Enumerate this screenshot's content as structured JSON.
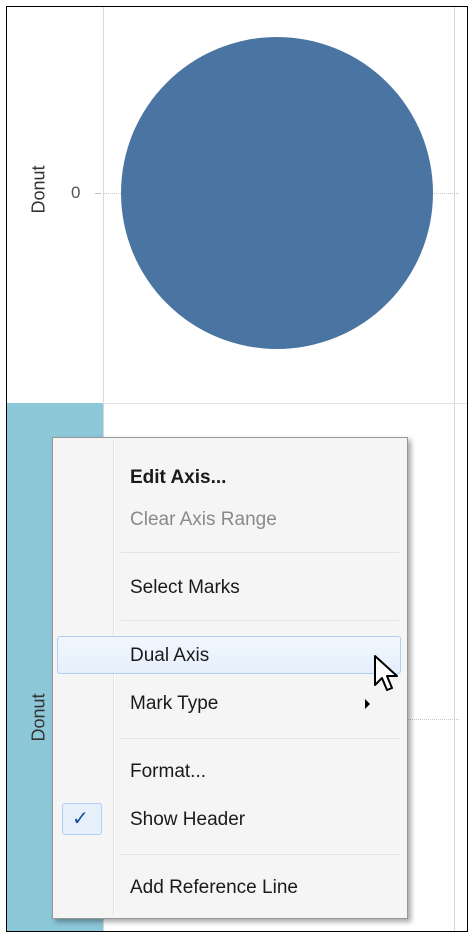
{
  "view": {
    "top_header": "Donut",
    "bottom_header": "Donut",
    "axis_tick": "0"
  },
  "colors": {
    "mark_fill": "#4a74a2",
    "selected_header": "#8dc8d9"
  },
  "context_menu": {
    "items": [
      {
        "label": "Edit Axis...",
        "state": "default"
      },
      {
        "label": "Clear Axis Range",
        "state": "disabled"
      },
      {
        "label": "Select Marks",
        "state": "default"
      },
      {
        "label": "Dual Axis",
        "state": "hovered"
      },
      {
        "label": "Mark Type",
        "state": "submenu"
      },
      {
        "label": "Format...",
        "state": "default"
      },
      {
        "label": "Show Header",
        "state": "checked"
      },
      {
        "label": "Add Reference Line",
        "state": "default"
      }
    ],
    "check_glyph": "✓"
  }
}
